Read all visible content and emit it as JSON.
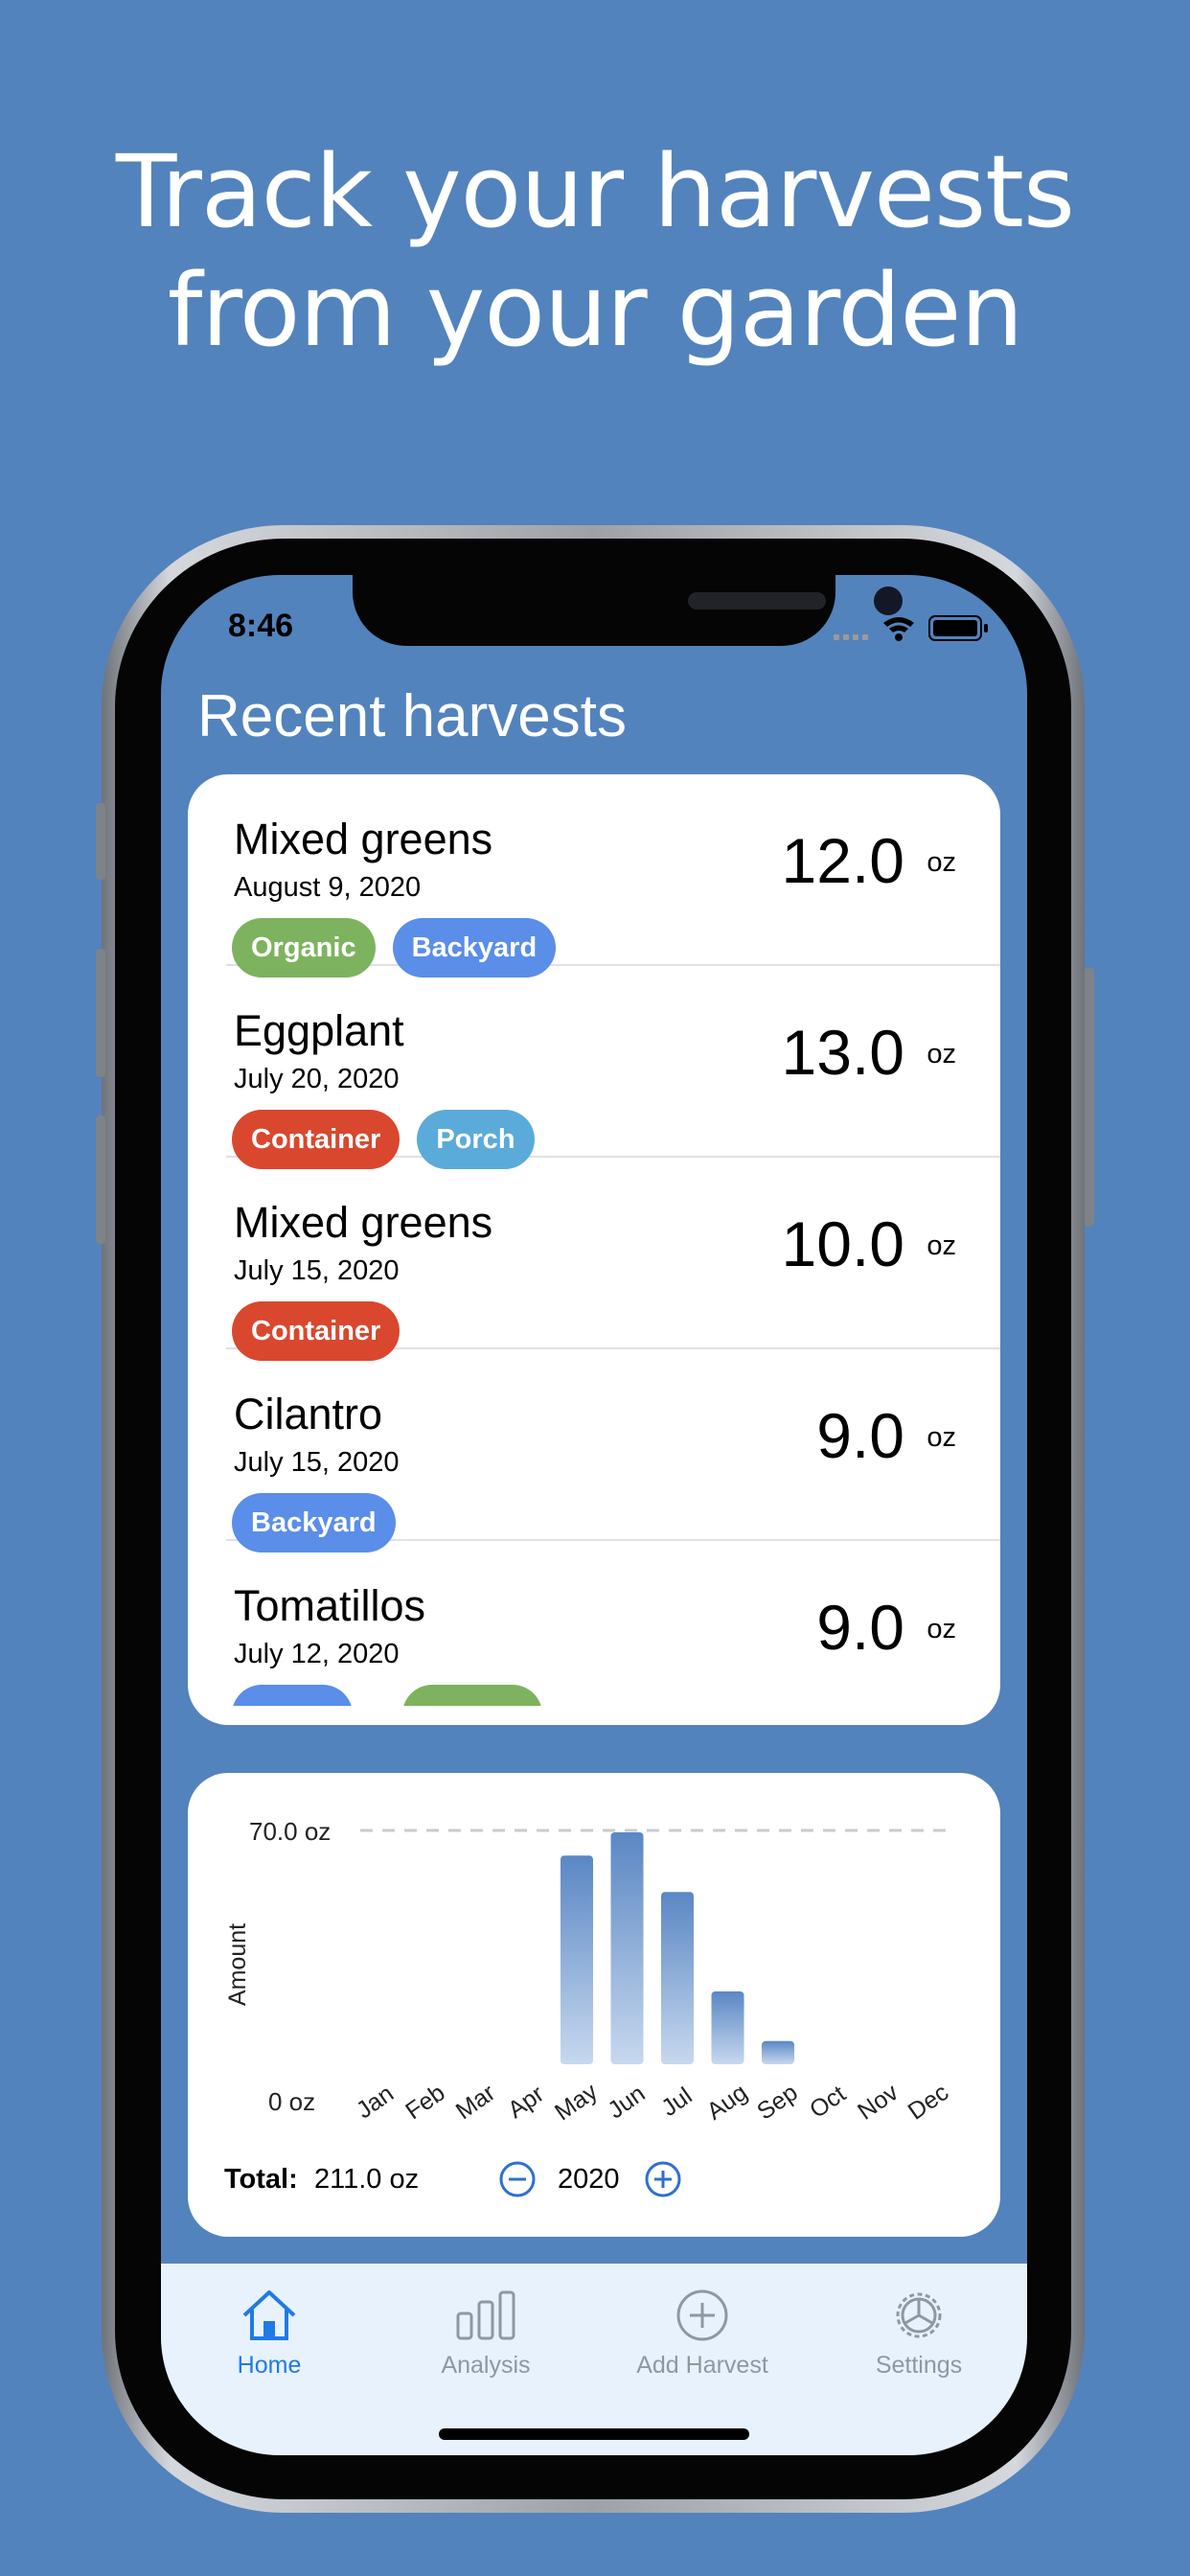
{
  "headline": {
    "line1": "Track your harvests",
    "line2": "from your garden"
  },
  "status_bar": {
    "time": "8:46"
  },
  "screen_title": "Recent harvests",
  "harvests": [
    {
      "name": "Mixed greens",
      "date": "August 9, 2020",
      "amount": "12.0",
      "unit": "oz",
      "tags": [
        {
          "label": "Organic",
          "color": "#7db35e"
        },
        {
          "label": "Backyard",
          "color": "#5a8ee8"
        }
      ]
    },
    {
      "name": "Eggplant",
      "date": "July 20, 2020",
      "amount": "13.0",
      "unit": "oz",
      "tags": [
        {
          "label": "Container",
          "color": "#d9472e"
        },
        {
          "label": "Porch",
          "color": "#5aabd9"
        }
      ]
    },
    {
      "name": "Mixed greens",
      "date": "July 15, 2020",
      "amount": "10.0",
      "unit": "oz",
      "tags": [
        {
          "label": "Container",
          "color": "#d9472e"
        }
      ]
    },
    {
      "name": "Cilantro",
      "date": "July 15, 2020",
      "amount": "9.0",
      "unit": "oz",
      "tags": [
        {
          "label": "Backyard",
          "color": "#5a8ee8"
        }
      ]
    },
    {
      "name": "Tomatillos",
      "date": "July 12, 2020",
      "amount": "9.0",
      "unit": "oz",
      "tags": [
        {
          "label": "",
          "color": "#5a8ee8"
        },
        {
          "label": "",
          "color": "#7db35e"
        }
      ]
    }
  ],
  "chart_data": {
    "type": "bar",
    "categories": [
      "Jan",
      "Feb",
      "Mar",
      "Apr",
      "May",
      "Jun",
      "Jul",
      "Aug",
      "Sep",
      "Oct",
      "Nov",
      "Dec"
    ],
    "values": [
      0,
      0,
      0,
      0,
      63,
      70,
      52,
      22,
      7,
      0,
      0,
      0
    ],
    "ylabel": "Amount",
    "ytick_top": "70.0 oz",
    "ytick_bottom": "0 oz",
    "ylim": [
      0,
      70
    ],
    "reference_line": 70,
    "bar_color": "#5a87c4"
  },
  "chart_footer": {
    "total_label": "Total:",
    "total_value": "211.0 oz",
    "year": "2020"
  },
  "tabs": [
    {
      "label": "Home",
      "icon": "house-icon",
      "active": true
    },
    {
      "label": "Analysis",
      "icon": "bar-chart-icon",
      "active": false
    },
    {
      "label": "Add Harvest",
      "icon": "plus-circle-icon",
      "active": false
    },
    {
      "label": "Settings",
      "icon": "gear-icon",
      "active": false
    }
  ]
}
